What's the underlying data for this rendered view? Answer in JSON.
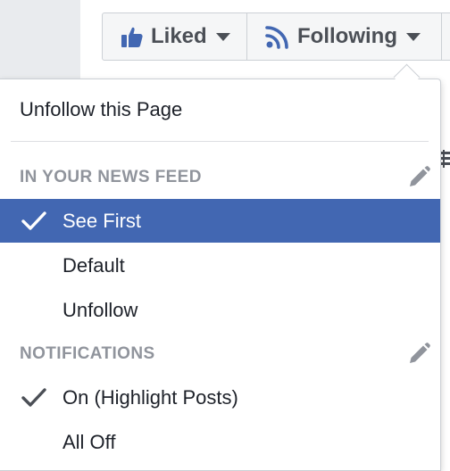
{
  "page_actions": {
    "liked_label": "Liked",
    "following_label": "Following"
  },
  "dropdown": {
    "unfollow_page_label": "Unfollow this Page",
    "news_feed": {
      "header": "IN YOUR NEWS FEED",
      "options": [
        {
          "label": "See First",
          "selected": true
        },
        {
          "label": "Default",
          "selected": false
        },
        {
          "label": "Unfollow",
          "selected": false
        }
      ]
    },
    "notifications": {
      "header": "NOTIFICATIONS",
      "options": [
        {
          "label": "On (Highlight Posts)",
          "selected": true
        },
        {
          "label": "All Off",
          "selected": false
        }
      ]
    }
  },
  "colors": {
    "selected_bg": "#4267b2",
    "icon_blue": "#4267b2",
    "header_gray": "#90949c",
    "text_dark": "#1d2129"
  }
}
